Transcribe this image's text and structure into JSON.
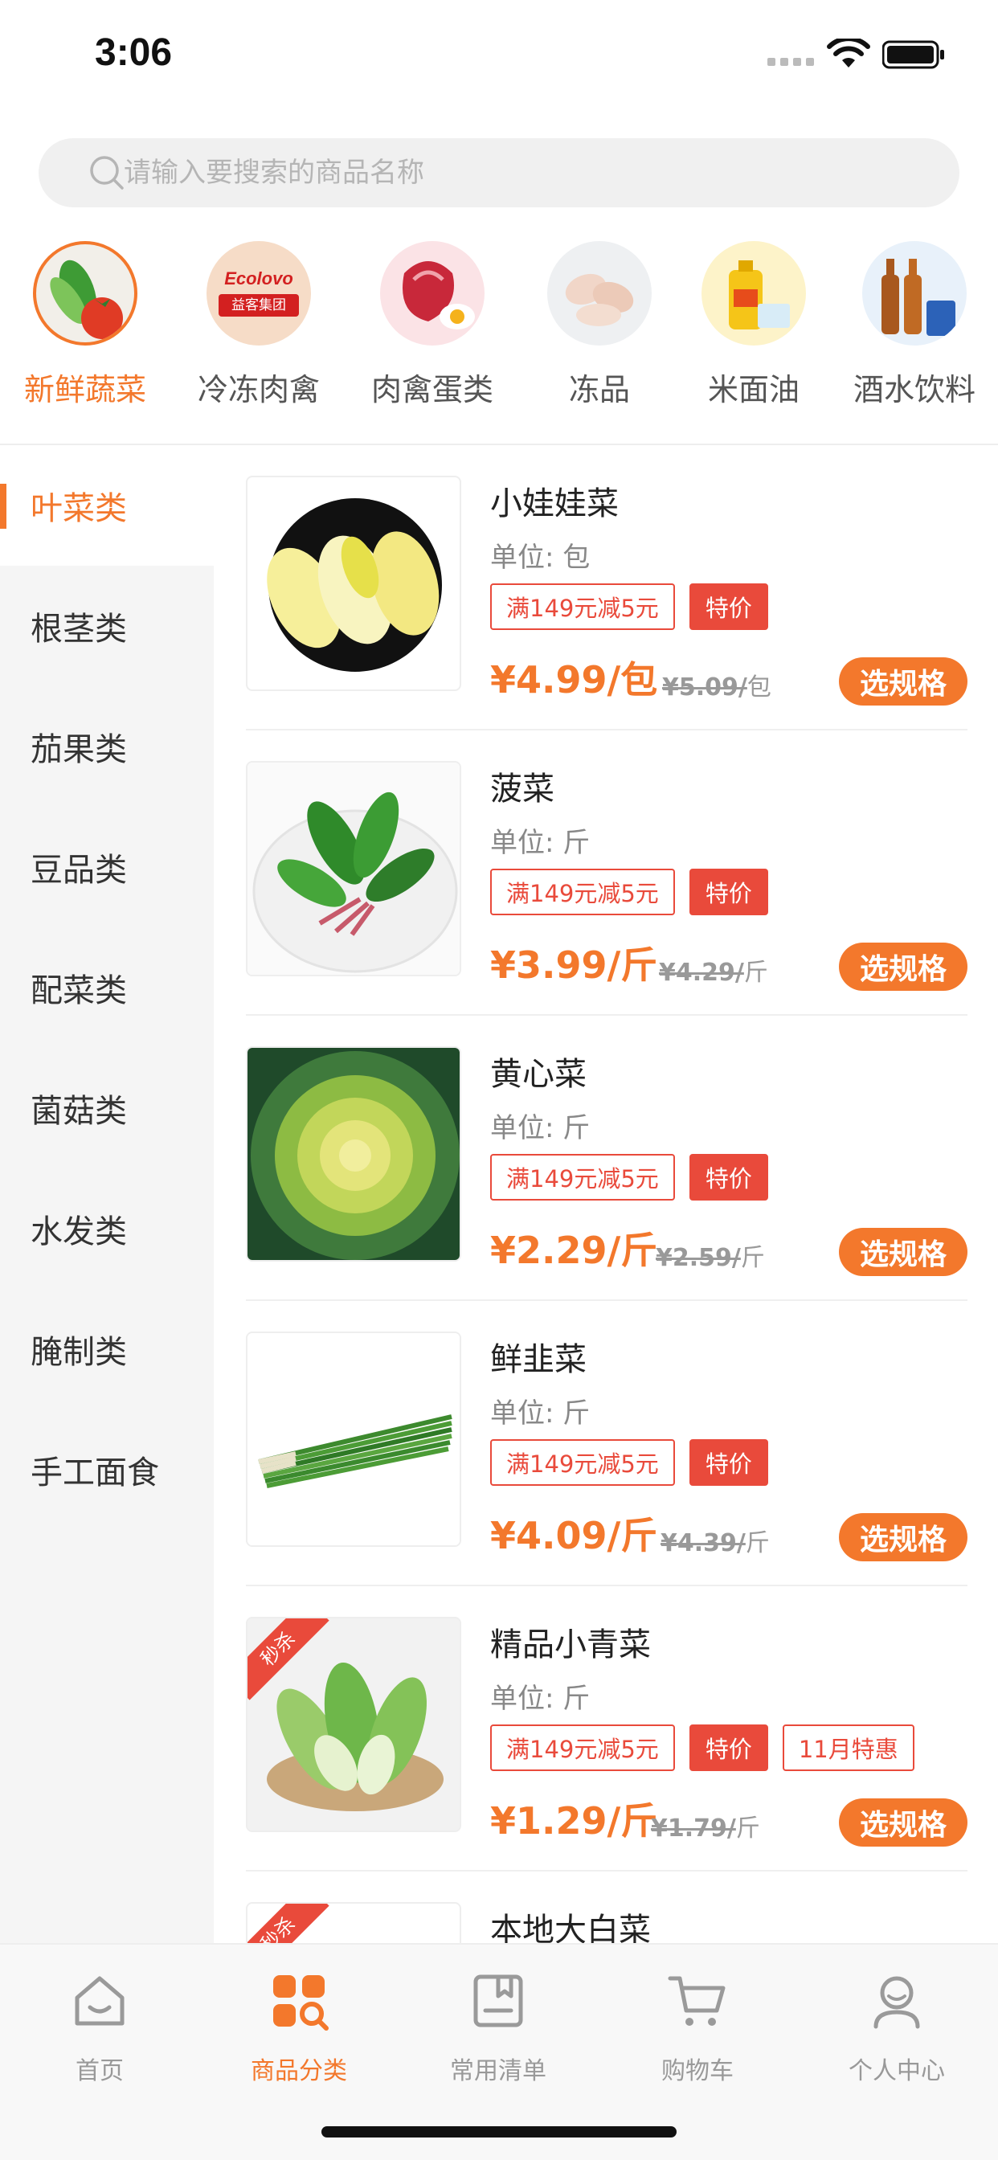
{
  "status_bar": {
    "time": "3:06"
  },
  "search": {
    "placeholder": "请输入要搜索的商品名称"
  },
  "categories": [
    {
      "label": "新鲜蔬菜",
      "icon": "vegetables-image",
      "active": true
    },
    {
      "label": "冷冻肉禽",
      "icon": "ecolovo-logo-image",
      "logo_text": "Ecolovo",
      "logo_subtext": "益客集团"
    },
    {
      "label": "肉禽蛋类",
      "icon": "meat-egg-image"
    },
    {
      "label": "冻品",
      "icon": "frozen-chicken-image"
    },
    {
      "label": "米面油",
      "icon": "cooking-oil-image"
    },
    {
      "label": "酒水饮料",
      "icon": "beverages-image"
    }
  ],
  "sidebar": {
    "items": [
      {
        "label": "叶菜类",
        "active": true
      },
      {
        "label": "根茎类"
      },
      {
        "label": "茄果类"
      },
      {
        "label": "豆品类"
      },
      {
        "label": "配菜类"
      },
      {
        "label": "菌菇类"
      },
      {
        "label": "水发类"
      },
      {
        "label": "腌制类"
      },
      {
        "label": "手工面食"
      }
    ]
  },
  "products": [
    {
      "name": "小娃娃菜",
      "unit": "单位: 包",
      "tags": [
        "满149元减5元",
        "特价"
      ],
      "price": "¥4.99/包",
      "old_price": "¥5.09/",
      "old_unit": "包",
      "button": "选规格",
      "image": "baby-cabbage-image"
    },
    {
      "name": "菠菜",
      "unit": "单位: 斤",
      "tags": [
        "满149元减5元",
        "特价"
      ],
      "price": "¥3.99/斤",
      "old_price": "¥4.29/",
      "old_unit": "斤",
      "button": "选规格",
      "image": "spinach-image"
    },
    {
      "name": "黄心菜",
      "unit": "单位: 斤",
      "tags": [
        "满149元减5元",
        "特价"
      ],
      "price": "¥2.29/斤",
      "old_price": "¥2.59/",
      "old_unit": "斤",
      "button": "选规格",
      "image": "yellow-heart-cabbage-image"
    },
    {
      "name": "鲜韭菜",
      "unit": "单位: 斤",
      "tags": [
        "满149元减5元",
        "特价"
      ],
      "price": "¥4.09/斤",
      "old_price": "¥4.39/",
      "old_unit": "斤",
      "button": "选规格",
      "image": "chives-image"
    },
    {
      "name": "精品小青菜",
      "unit": "单位: 斤",
      "tags": [
        "满149元减5元",
        "特价",
        "11月特惠"
      ],
      "price": "¥1.29/斤",
      "old_price": "¥1.79/",
      "old_unit": "斤",
      "button": "选规格",
      "image": "bok-choy-image",
      "badge": "秒杀"
    },
    {
      "name": "本地大白菜",
      "badge": "秒杀",
      "image": "napa-cabbage-image"
    }
  ],
  "tab_bar": {
    "items": [
      {
        "label": "首页",
        "icon": "home-icon"
      },
      {
        "label": "商品分类",
        "icon": "category-icon",
        "active": true
      },
      {
        "label": "常用清单",
        "icon": "list-icon"
      },
      {
        "label": "购物车",
        "icon": "cart-icon"
      },
      {
        "label": "个人中心",
        "icon": "profile-icon"
      }
    ]
  },
  "colors": {
    "accent": "#f3782c",
    "tag_red": "#e94a3b",
    "sidebar_bg": "#f5f5f5"
  }
}
